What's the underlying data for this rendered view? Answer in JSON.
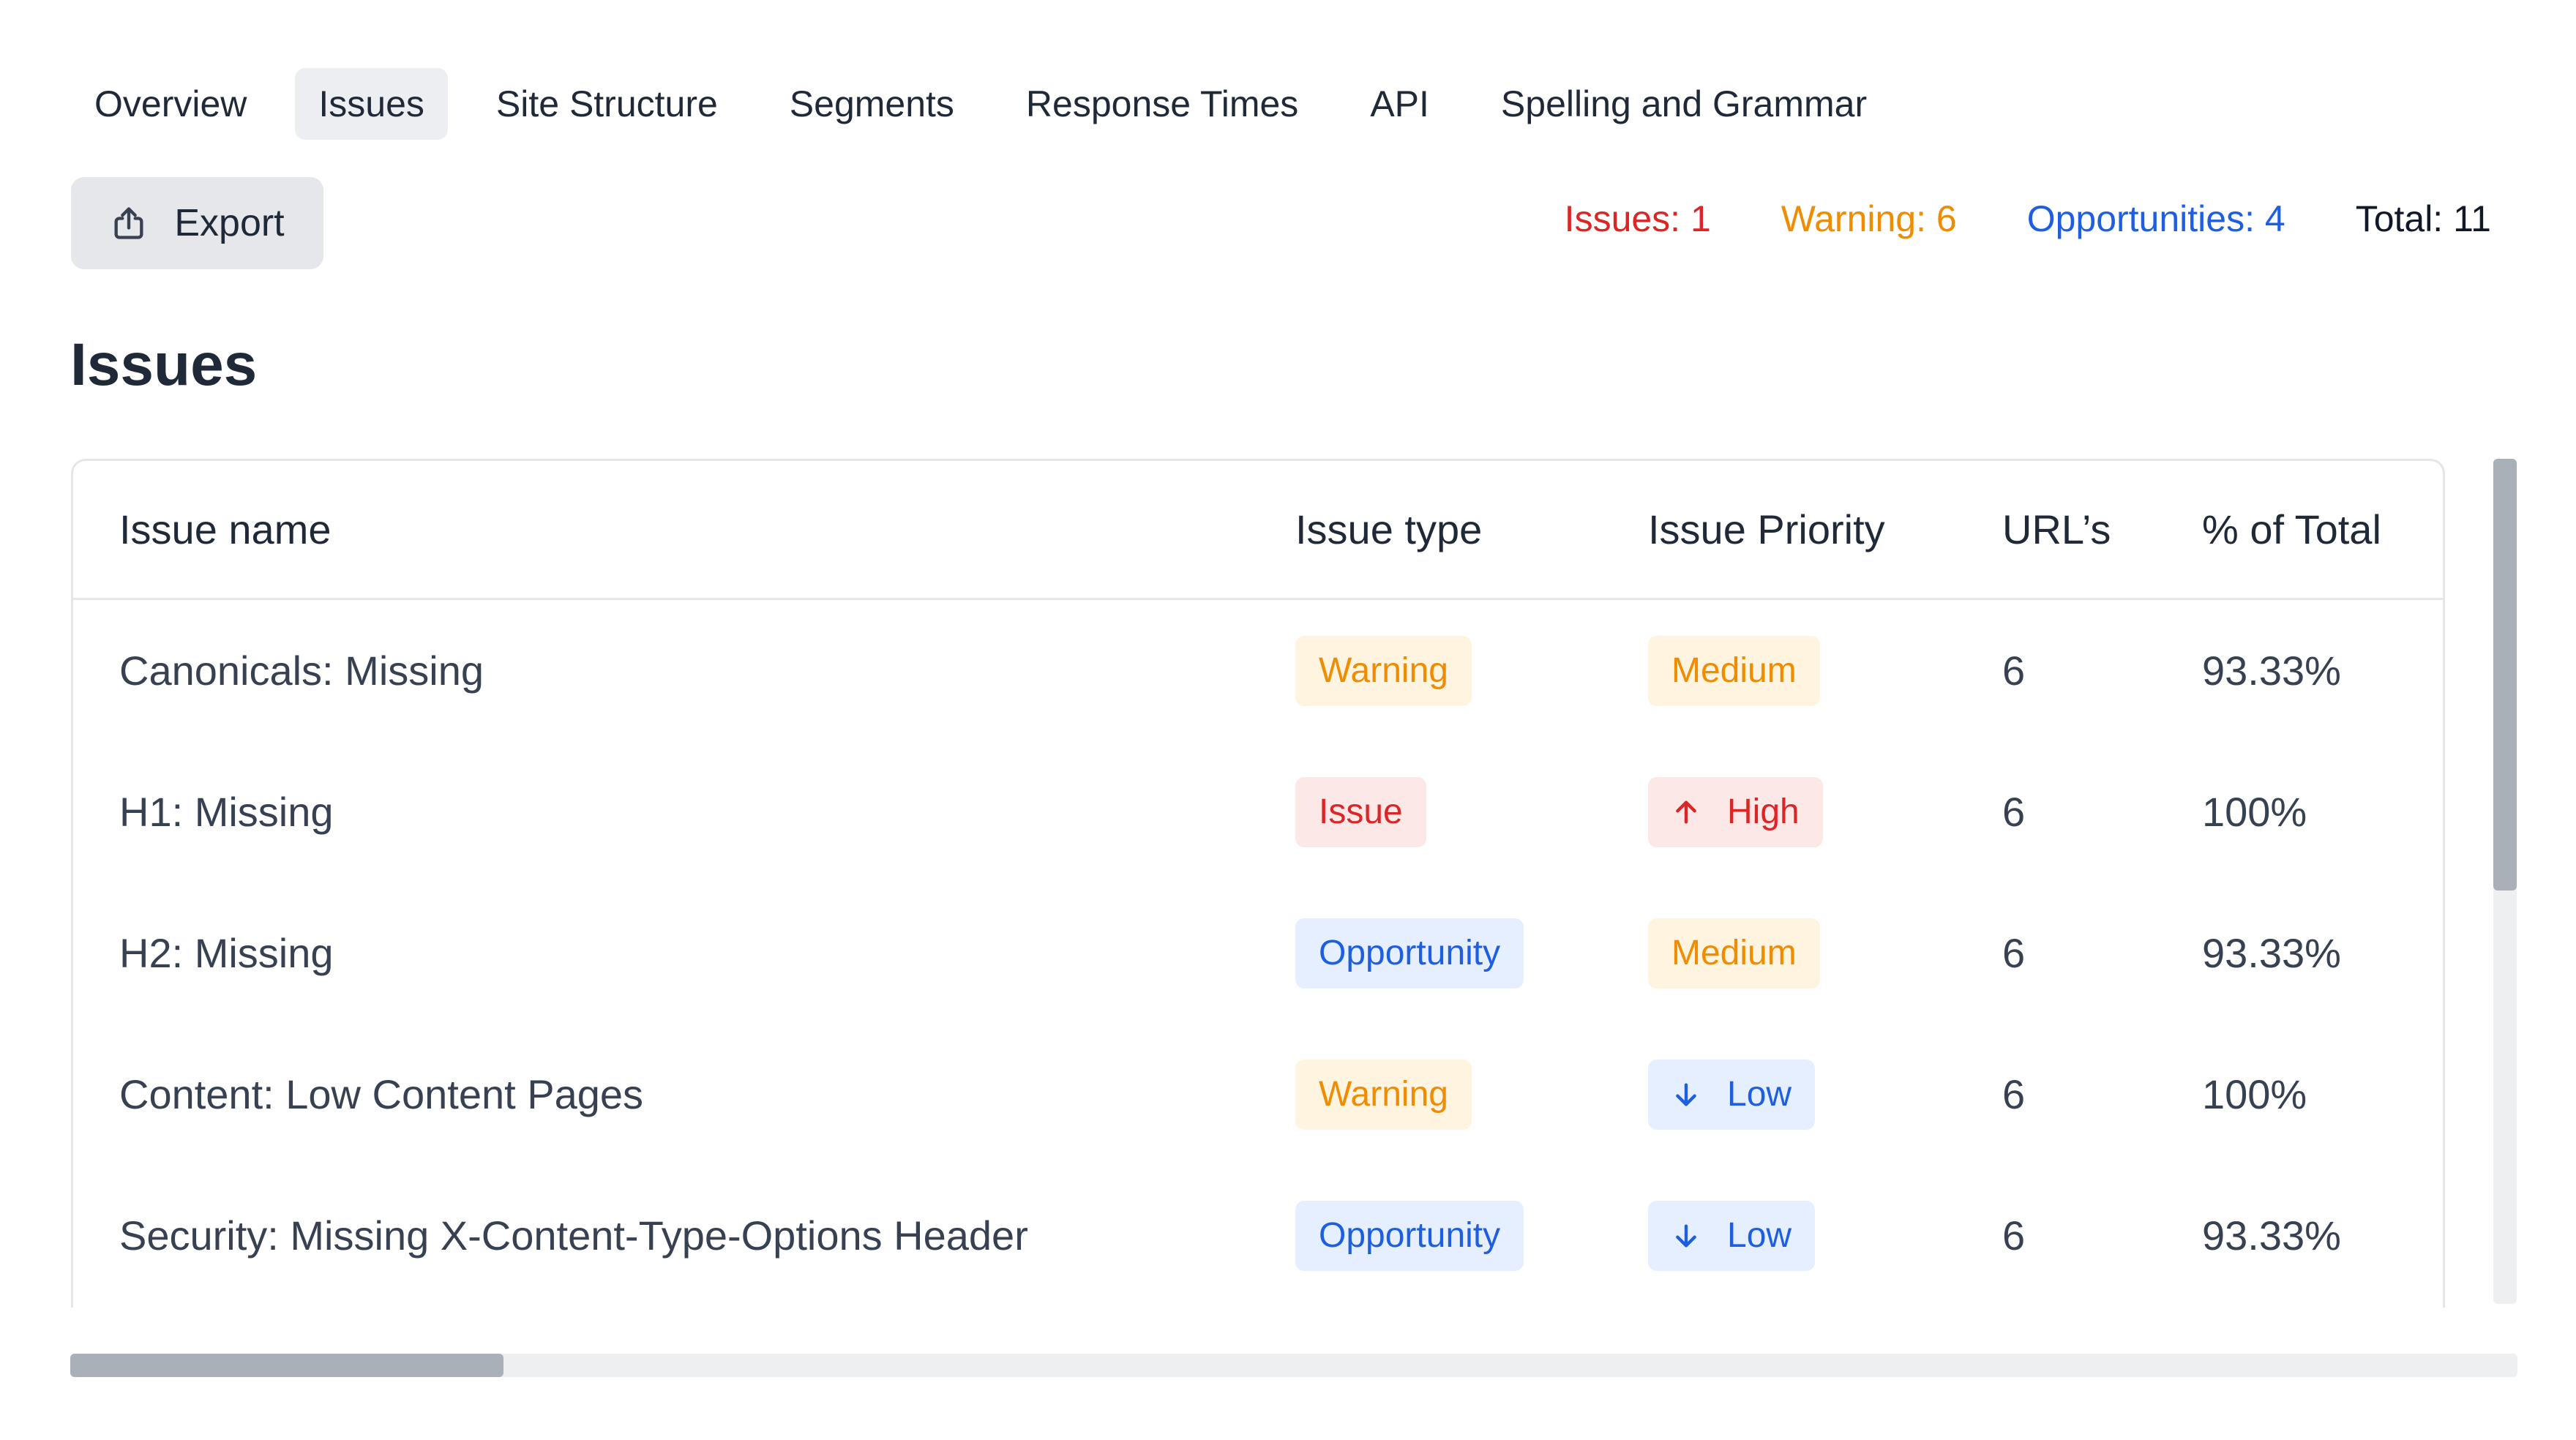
{
  "tabs": [
    {
      "label": "Overview",
      "active": false
    },
    {
      "label": "Issues",
      "active": true
    },
    {
      "label": "Site Structure",
      "active": false
    },
    {
      "label": "Segments",
      "active": false
    },
    {
      "label": "Response Times",
      "active": false
    },
    {
      "label": "API",
      "active": false
    },
    {
      "label": "Spelling and Grammar",
      "active": false
    }
  ],
  "toolbar": {
    "export_label": "Export",
    "export_icon": "upload-share-icon"
  },
  "summary": {
    "issues": "Issues: 1",
    "warning": "Warning: 6",
    "opportunities": "Opportunities: 4",
    "total": "Total: 11"
  },
  "section_title": "Issues",
  "table": {
    "headers": {
      "name": "Issue name",
      "type": "Issue type",
      "priority": "Issue Priority",
      "urls": "URL’s",
      "pct": "% of Total"
    },
    "rows": [
      {
        "name": "Canonicals: Missing",
        "type": "Warning",
        "type_kind": "warning",
        "priority": "Medium",
        "priority_kind": "warning",
        "priority_icon": "",
        "urls": "6",
        "pct": "93.33%"
      },
      {
        "name": "H1: Missing",
        "type": "Issue",
        "type_kind": "issue",
        "priority": "High",
        "priority_kind": "issue",
        "priority_icon": "arrow-up-icon",
        "urls": "6",
        "pct": "100%"
      },
      {
        "name": "H2: Missing",
        "type": "Opportunity",
        "type_kind": "opportunity",
        "priority": "Medium",
        "priority_kind": "warning",
        "priority_icon": "",
        "urls": "6",
        "pct": "93.33%"
      },
      {
        "name": "Content: Low Content Pages",
        "type": "Warning",
        "type_kind": "warning",
        "priority": "Low",
        "priority_kind": "opportunity",
        "priority_icon": "arrow-down-icon",
        "urls": "6",
        "pct": "100%"
      },
      {
        "name": "Security: Missing X-Content-Type-Options Header",
        "type": "Opportunity",
        "type_kind": "opportunity",
        "priority": "Low",
        "priority_kind": "opportunity",
        "priority_icon": "arrow-down-icon",
        "urls": "6",
        "pct": "93.33%"
      }
    ]
  },
  "colors": {
    "issue": "#dc2626",
    "warning": "#f08c00",
    "opportunity": "#1d5fe0",
    "active_tab_bg": "#eceef1"
  }
}
